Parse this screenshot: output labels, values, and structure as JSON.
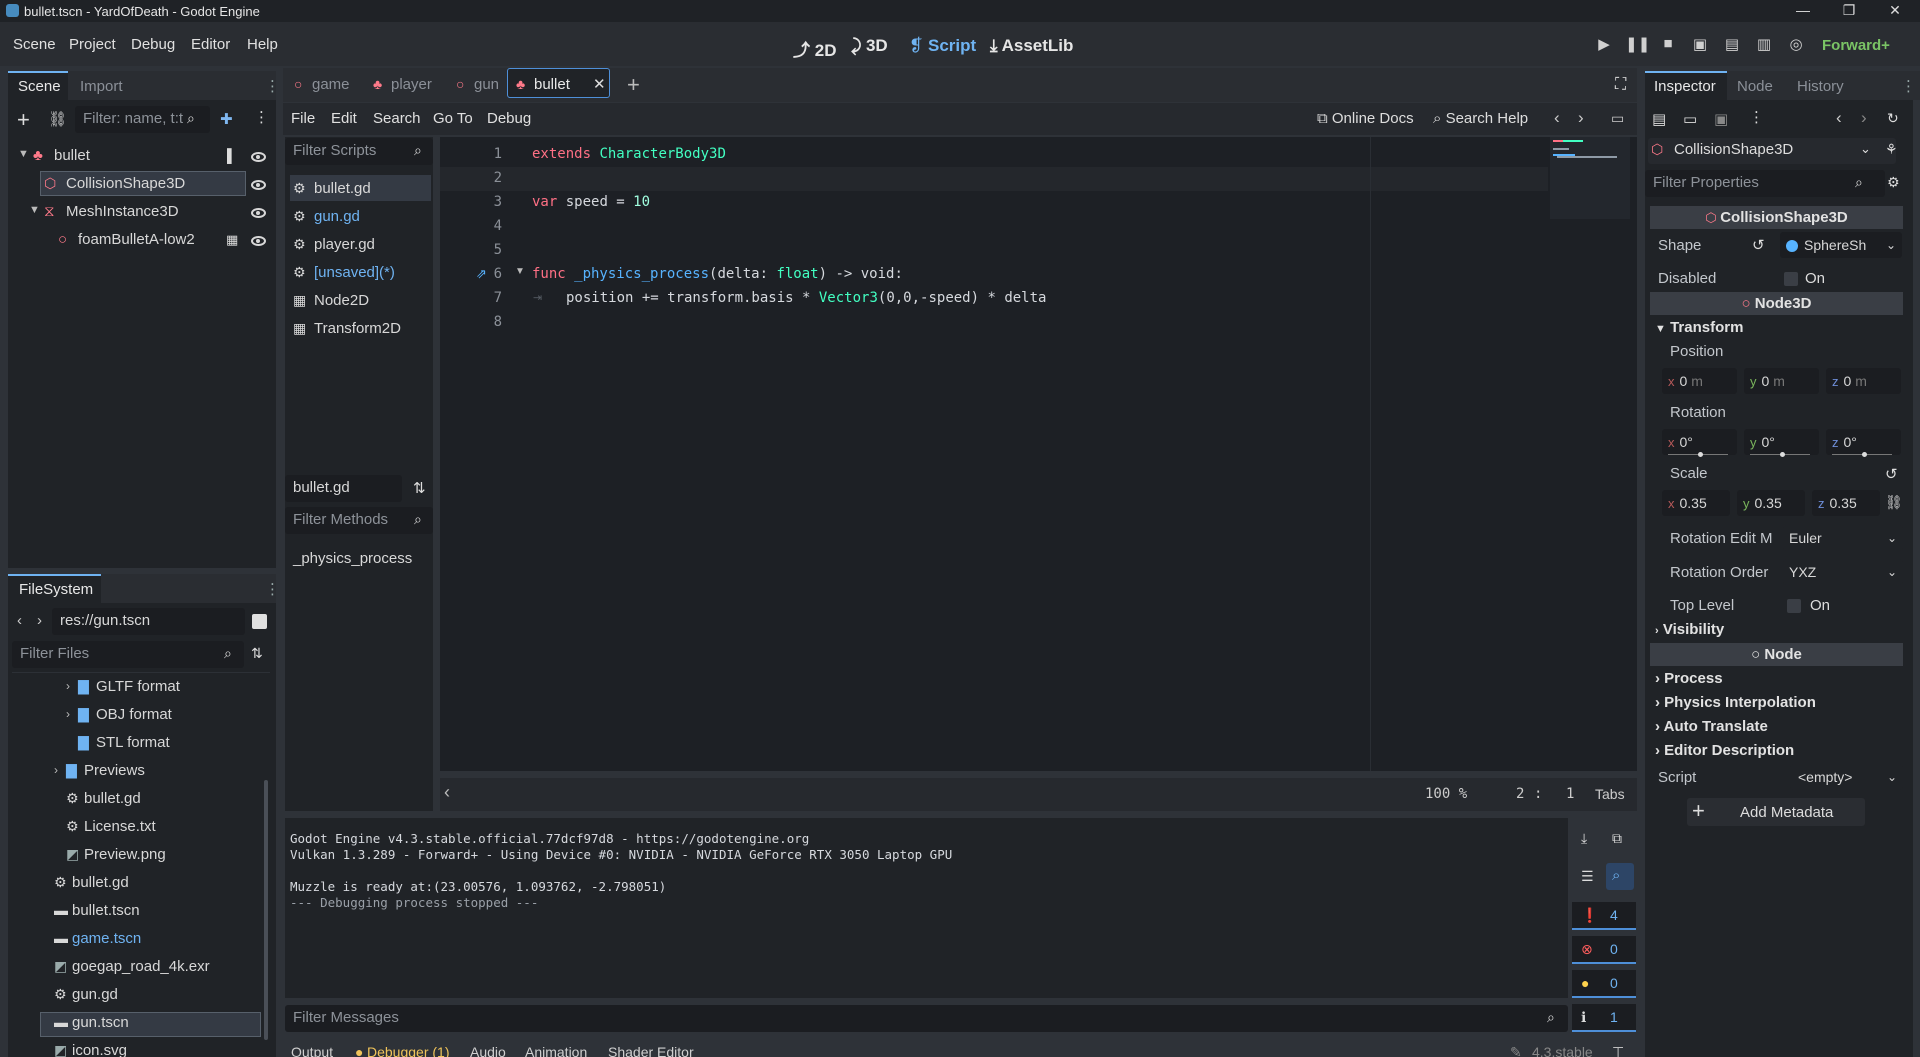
{
  "window": {
    "title": "bullet.tscn - YardOfDeath - Godot Engine",
    "minimize": "—",
    "maximize": "❐",
    "close": "✕"
  },
  "menubar": {
    "items": [
      "Scene",
      "Project",
      "Debug",
      "Editor",
      "Help"
    ],
    "workspaces": [
      {
        "icon": "⤴",
        "label": "2D"
      },
      {
        "icon": "⤸",
        "label": "3D"
      },
      {
        "icon": "❡",
        "label": "Script"
      },
      {
        "icon": "⤓",
        "label": "AssetLib"
      }
    ],
    "renderer": "Forward+",
    "run_icons": [
      "play-icon",
      "pause-icon",
      "stop-icon",
      "remote-deploy-icon",
      "play-scene-icon",
      "play-custom-icon",
      "movie-maker-icon"
    ]
  },
  "scene_dock": {
    "tabs": [
      "Scene",
      "Import"
    ],
    "filter_placeholder": "Filter: name, t:t",
    "tree": [
      {
        "name": "bullet",
        "level": 0
      },
      {
        "name": "CollisionShape3D",
        "level": 1,
        "selected": true
      },
      {
        "name": "MeshInstance3D",
        "level": 1
      },
      {
        "name": "foamBulletA-low2",
        "level": 2
      }
    ]
  },
  "filesystem": {
    "tab": "FileSystem",
    "path": "res://gun.tscn",
    "filter_placeholder": "Filter Files",
    "items": [
      {
        "name": "GLTF format",
        "type": "folder",
        "indent": 2,
        "arrow": true
      },
      {
        "name": "OBJ format",
        "type": "folder",
        "indent": 2,
        "arrow": true
      },
      {
        "name": "STL format",
        "type": "folder",
        "indent": 2,
        "arrow": false
      },
      {
        "name": "Previews",
        "type": "folder",
        "indent": 1,
        "arrow": true
      },
      {
        "name": "bullet.gd",
        "type": "script",
        "indent": 1
      },
      {
        "name": "License.txt",
        "type": "text",
        "indent": 1
      },
      {
        "name": "Preview.png",
        "type": "image",
        "indent": 1
      },
      {
        "name": "bullet.gd",
        "type": "script",
        "indent": 0
      },
      {
        "name": "bullet.tscn",
        "type": "scene",
        "indent": 0
      },
      {
        "name": "game.tscn",
        "type": "scene",
        "indent": 0,
        "highlight": true
      },
      {
        "name": "goegap_road_4k.exr",
        "type": "image",
        "indent": 0
      },
      {
        "name": "gun.gd",
        "type": "script",
        "indent": 0
      },
      {
        "name": "gun.tscn",
        "type": "scene",
        "indent": 0,
        "selected": true
      },
      {
        "name": "icon.svg",
        "type": "image",
        "indent": 0
      }
    ]
  },
  "scene_tabs": [
    {
      "label": "game",
      "icon": "○"
    },
    {
      "label": "player",
      "icon": "♣"
    },
    {
      "label": "gun",
      "icon": "○"
    },
    {
      "label": "bullet",
      "icon": "♣",
      "active": true
    }
  ],
  "script_menu": {
    "items": [
      "File",
      "Edit",
      "Search",
      "Go To",
      "Debug"
    ],
    "online_docs": "Online Docs",
    "search_help": "Search Help"
  },
  "script_list": {
    "filter_placeholder": "Filter Scripts",
    "items": [
      {
        "name": "bullet.gd",
        "selected": true
      },
      {
        "name": "gun.gd",
        "blue": true
      },
      {
        "name": "player.gd"
      },
      {
        "name": "[unsaved](*)",
        "blue": true
      },
      {
        "name": "Node2D"
      },
      {
        "name": "Transform2D"
      }
    ],
    "current": "bullet.gd",
    "methods_placeholder": "Filter Methods",
    "methods": [
      "_physics_process"
    ]
  },
  "code": {
    "lines": [
      "1",
      "2",
      "3",
      "4",
      "5",
      "6",
      "7",
      "8"
    ],
    "line1": {
      "kw": "extends",
      "ty": "CharacterBody3D"
    },
    "line3": {
      "kw": "var",
      "rest": " speed = ",
      "num": "10"
    },
    "line6": {
      "kw": "func",
      "fn": " _physics_process",
      "p1": "(delta: ",
      "ty": "float",
      "p2": ") -> void:"
    },
    "line7": {
      "a": "position += transform.basis * ",
      "ty": "Vector3",
      "b": "(0,0,-speed) * delta"
    }
  },
  "status": {
    "zoom": "100 %",
    "line": "2",
    "sep": ":",
    "col": "1",
    "indent": "Tabs"
  },
  "output": {
    "lines": [
      "Godot Engine v4.3.stable.official.77dcf97d8 - https://godotengine.org",
      "Vulkan 1.3.289 - Forward+ - Using Device #0: NVIDIA - NVIDIA GeForce RTX 3050 Laptop GPU",
      "",
      "Muzzle is ready at:(23.00576, 1.093762, -2.798051)",
      "--- Debugging process stopped ---"
    ],
    "filter_placeholder": "Filter Messages",
    "counts": {
      "messages": "4",
      "errors": "0",
      "warnings": "0",
      "info": "1"
    }
  },
  "bottom_tabs": [
    "Output",
    "Debugger (1)",
    "Audio",
    "Animation",
    "Shader Editor"
  ],
  "version": "4.3.stable",
  "inspector": {
    "tabs": [
      "Inspector",
      "Node",
      "History"
    ],
    "object": "CollisionShape3D",
    "filter_placeholder": "Filter Properties",
    "sections": {
      "collision": "CollisionShape3D",
      "node3d": "Node3D",
      "node": "Node"
    },
    "shape_label": "Shape",
    "shape_value": "SphereSh",
    "disabled_label": "Disabled",
    "on": "On",
    "transform": "Transform",
    "position": "Position",
    "pos": {
      "x": "0",
      "y": "0",
      "z": "0",
      "unit": "m"
    },
    "rotation": "Rotation",
    "rot": {
      "x": "0°",
      "y": "0°",
      "z": "0°"
    },
    "scale": "Scale",
    "scl": {
      "x": "0.35",
      "y": "0.35",
      "z": "0.35"
    },
    "axis": {
      "x": "x",
      "y": "y",
      "z": "z"
    },
    "rotation_edit_label": "Rotation Edit M",
    "rotation_edit_value": "Euler",
    "rotation_order_label": "Rotation Order",
    "rotation_order_value": "YXZ",
    "top_level": "Top Level",
    "visibility": "Visibility",
    "groups": [
      "Process",
      "Physics Interpolation",
      "Auto Translate",
      "Editor Description"
    ],
    "script_label": "Script",
    "script_value": "<empty>",
    "add_metadata": "Add Metadata"
  }
}
